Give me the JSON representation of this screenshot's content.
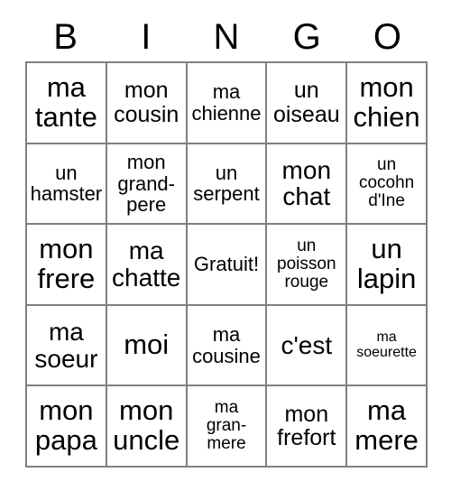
{
  "card": {
    "title": "BINGO",
    "header_letters": [
      "B",
      "I",
      "N",
      "G",
      "O"
    ],
    "free_space_label": "Gratuit!",
    "colors": {
      "text": "#000000",
      "grid_line": "#808080",
      "background": "#ffffff"
    },
    "rows": [
      [
        {
          "text": "ma\ntante",
          "size": "xxl"
        },
        {
          "text": "mon\ncousin",
          "size": "lg"
        },
        {
          "text": "ma\nchienne",
          "size": "md"
        },
        {
          "text": "un\noiseau",
          "size": "lg"
        },
        {
          "text": "mon\nchien",
          "size": "xxl"
        }
      ],
      [
        {
          "text": "un\nhamster",
          "size": "md"
        },
        {
          "text": "mon\ngrand-\npere",
          "size": "md"
        },
        {
          "text": "un\nserpent",
          "size": "md"
        },
        {
          "text": "mon\nchat",
          "size": "xl"
        },
        {
          "text": "un\ncocohn\nd'Ine",
          "size": "sm"
        }
      ],
      [
        {
          "text": "mon\nfrere",
          "size": "xxl"
        },
        {
          "text": "ma\nchatte",
          "size": "xl"
        },
        {
          "text": "Gratuit!",
          "size": "md"
        },
        {
          "text": "un\npoisson\nrouge",
          "size": "sm"
        },
        {
          "text": "un\nlapin",
          "size": "xxl"
        }
      ],
      [
        {
          "text": "ma\nsoeur",
          "size": "xl"
        },
        {
          "text": "moi",
          "size": "xxl"
        },
        {
          "text": "ma\ncousine",
          "size": "md"
        },
        {
          "text": "c'est",
          "size": "xl"
        },
        {
          "text": "ma\nsoeurette",
          "size": "xs"
        }
      ],
      [
        {
          "text": "mon\npapa",
          "size": "xxl"
        },
        {
          "text": "mon\nuncle",
          "size": "xxl"
        },
        {
          "text": "ma\ngran-\nmere",
          "size": "sm"
        },
        {
          "text": "mon\nfrefort",
          "size": "lg"
        },
        {
          "text": "ma\nmere",
          "size": "xxl"
        }
      ]
    ]
  }
}
